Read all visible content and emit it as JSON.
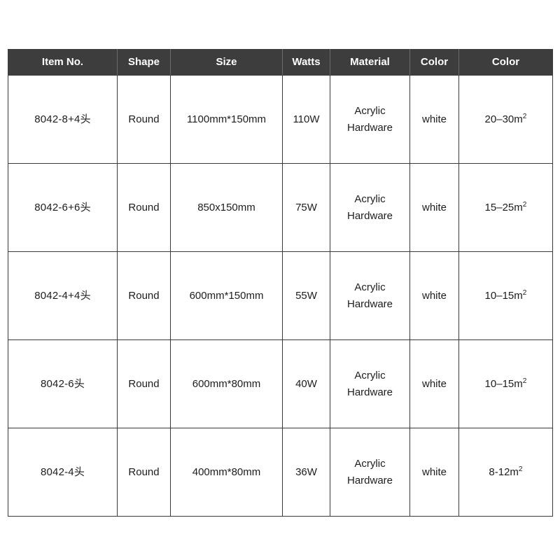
{
  "table": {
    "columns": [
      {
        "key": "item_no",
        "label": "Item No.",
        "name": "item-no"
      },
      {
        "key": "shape",
        "label": "Shape",
        "name": "shape"
      },
      {
        "key": "size",
        "label": "Size",
        "name": "size"
      },
      {
        "key": "watts",
        "label": "Watts",
        "name": "watts"
      },
      {
        "key": "material",
        "label": "Material",
        "name": "material"
      },
      {
        "key": "color",
        "label": "Color",
        "name": "color"
      },
      {
        "key": "area",
        "label": "Color",
        "name": "color-2"
      }
    ],
    "rows": [
      {
        "item_no": "8042-8+4头",
        "shape": "Round",
        "size": "1100mm*150mm",
        "watts": "110W",
        "material_line1": "Acrylic",
        "material_line2": "Hardware",
        "color": "white",
        "area_value": "20–30m",
        "area_unit": "2"
      },
      {
        "item_no": "8042-6+6头",
        "shape": "Round",
        "size": "850x150mm",
        "watts": "75W",
        "material_line1": "Acrylic",
        "material_line2": "Hardware",
        "color": "white",
        "area_value": "15–25m",
        "area_unit": "2"
      },
      {
        "item_no": "8042-4+4头",
        "shape": "Round",
        "size": "600mm*150mm",
        "watts": "55W",
        "material_line1": "Acrylic",
        "material_line2": "Hardware",
        "color": "white",
        "area_value": "10–15m",
        "area_unit": "2"
      },
      {
        "item_no": "8042-6头",
        "shape": "Round",
        "size": "600mm*80mm",
        "watts": "40W",
        "material_line1": "Acrylic",
        "material_line2": "Hardware",
        "color": "white",
        "area_value": "10–15m",
        "area_unit": "2"
      },
      {
        "item_no": "8042-4头",
        "shape": "Round",
        "size": "400mm*80mm",
        "watts": "36W",
        "material_line1": "Acrylic",
        "material_line2": "Hardware",
        "color": "white",
        "area_value": "8-12m",
        "area_unit": "2"
      }
    ]
  },
  "style": {
    "header_background": "#3d3d3d",
    "header_text_color": "#ffffff",
    "border_color": "#2a2a2a",
    "body_background": "#ffffff",
    "body_text_color": "#1d1d1d"
  }
}
